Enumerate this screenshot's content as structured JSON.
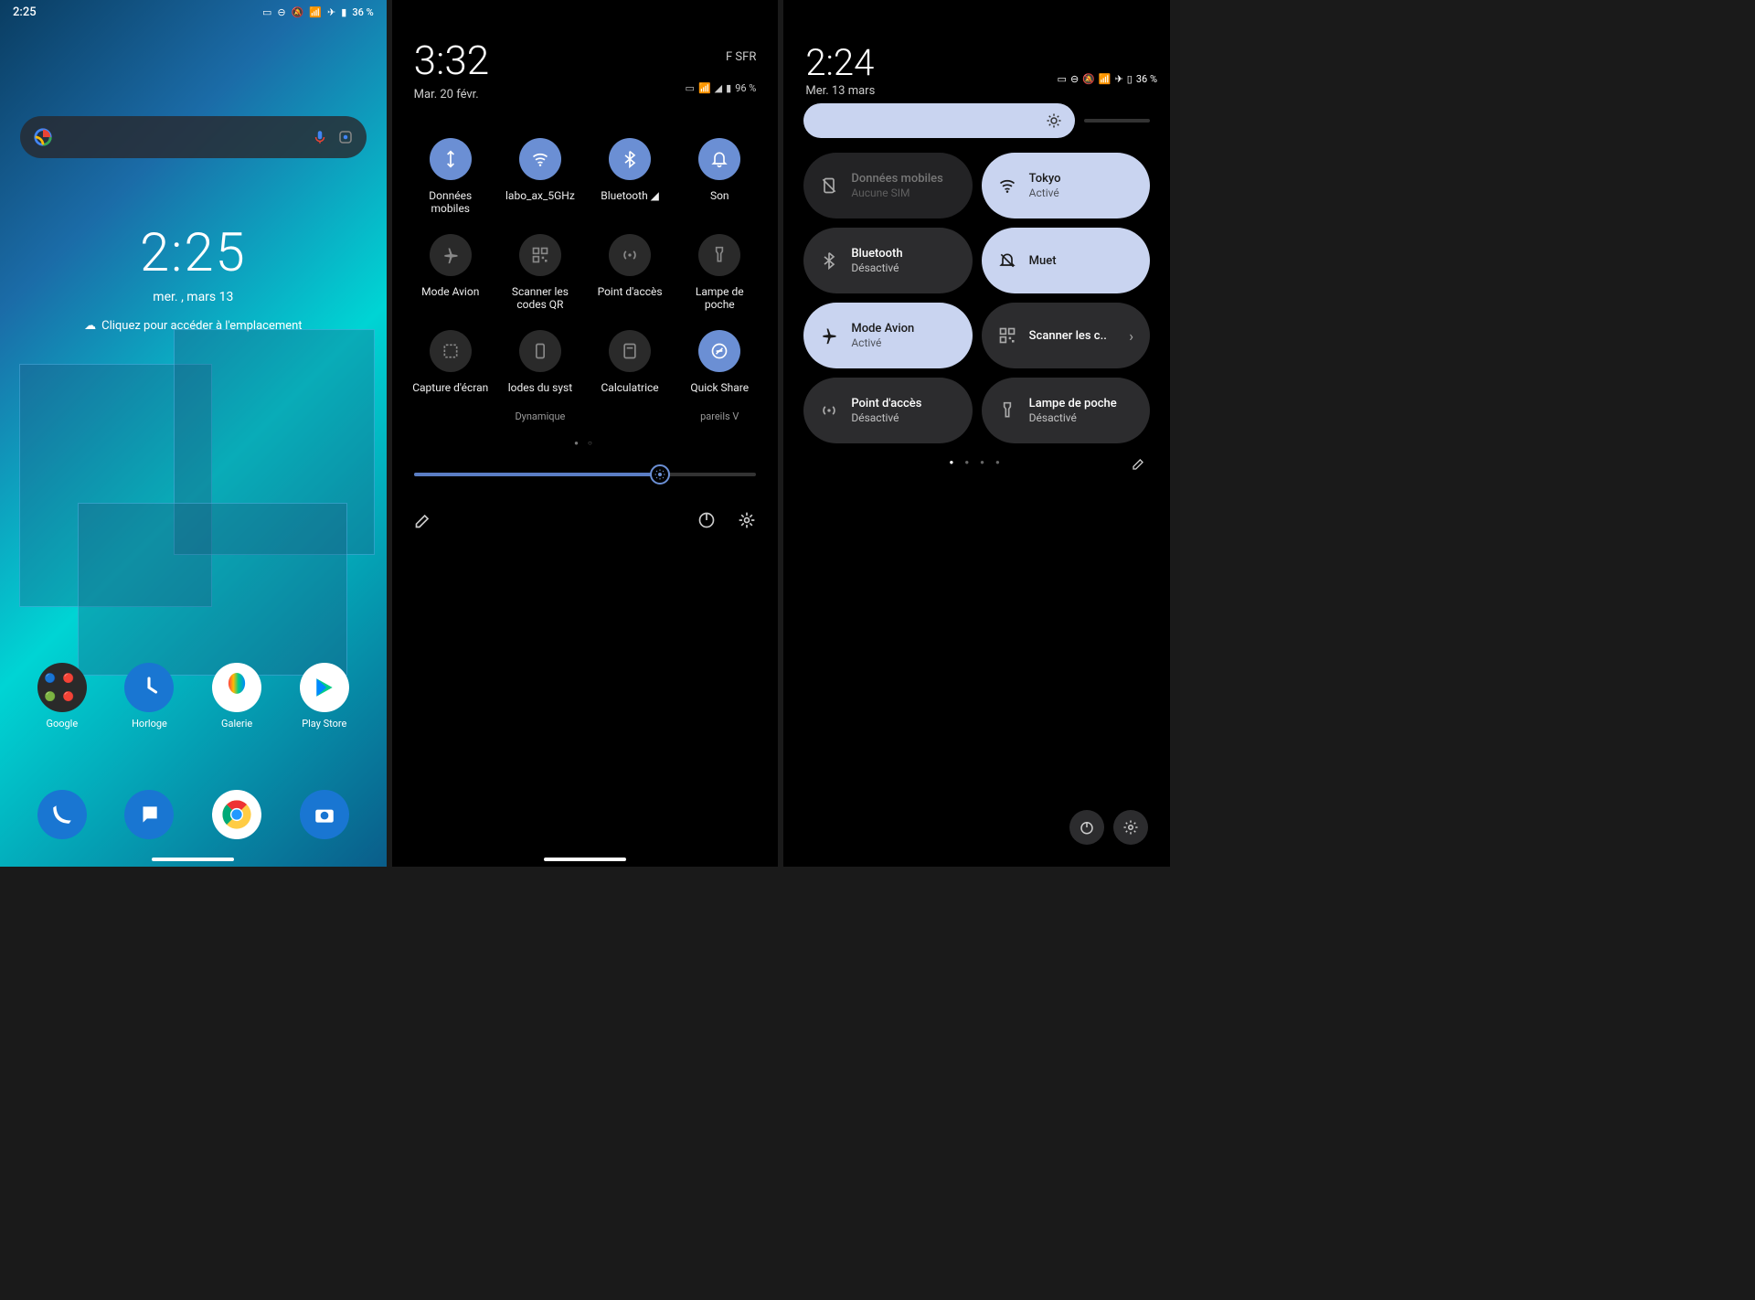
{
  "pane1": {
    "status_time": "2:25",
    "battery": "36 %",
    "clock": "2:25",
    "date": "mer. , mars 13",
    "location_hint": "Cliquez pour accéder à l'emplacement",
    "apps": [
      {
        "label": "Google"
      },
      {
        "label": "Horloge"
      },
      {
        "label": "Galerie"
      },
      {
        "label": "Play Store"
      }
    ]
  },
  "pane2": {
    "time": "3:32",
    "date": "Mar. 20 févr.",
    "carrier": "F SFR",
    "battery": "96 %",
    "tiles": [
      {
        "label": "Données mobiles",
        "sub": "",
        "on": true,
        "icon": "data"
      },
      {
        "label": "labo_ax_5GHz",
        "sub": "",
        "on": true,
        "icon": "wifi"
      },
      {
        "label": "Bluetooth ◢",
        "sub": "",
        "on": true,
        "icon": "bt"
      },
      {
        "label": "Son",
        "sub": "",
        "on": true,
        "icon": "bell"
      },
      {
        "label": "Mode Avion",
        "sub": "",
        "on": false,
        "icon": "plane"
      },
      {
        "label": "Scanner les codes QR",
        "sub": "",
        "on": false,
        "icon": "qr"
      },
      {
        "label": "Point d'accès",
        "sub": "",
        "on": false,
        "icon": "hotspot"
      },
      {
        "label": "Lampe de poche",
        "sub": "",
        "on": false,
        "icon": "torch"
      },
      {
        "label": "Capture d'écran",
        "sub": "",
        "on": false,
        "icon": "screenshot"
      },
      {
        "label": "lodes du syst",
        "sub": "Dynamique",
        "on": false,
        "icon": "phone"
      },
      {
        "label": "Calculatrice",
        "sub": "",
        "on": false,
        "icon": "calc"
      },
      {
        "label": "Quick Share",
        "sub": "pareils    V",
        "on": true,
        "icon": "share"
      }
    ],
    "brightness": 72
  },
  "pane3": {
    "time": "2:24",
    "date": "Mer. 13 mars",
    "battery": "36 %",
    "tiles": [
      {
        "title": "Données mobiles",
        "sub": "Aucune SIM",
        "state": "dim",
        "icon": "nosim"
      },
      {
        "title": "Tokyo",
        "sub": "Activé",
        "state": "on",
        "icon": "wifi"
      },
      {
        "title": "Bluetooth",
        "sub": "Désactivé",
        "state": "off",
        "icon": "bt"
      },
      {
        "title": "Muet",
        "sub": "",
        "state": "on",
        "icon": "mute"
      },
      {
        "title": "Mode Avion",
        "sub": "Activé",
        "state": "on",
        "icon": "plane"
      },
      {
        "title": "Scanner les c..",
        "sub": "",
        "state": "off",
        "icon": "qr",
        "chevron": true
      },
      {
        "title": "Point d'accès",
        "sub": "Désactivé",
        "state": "off",
        "icon": "hotspot"
      },
      {
        "title": "Lampe de poche",
        "sub": "Désactivé",
        "state": "off",
        "icon": "torch"
      }
    ]
  }
}
